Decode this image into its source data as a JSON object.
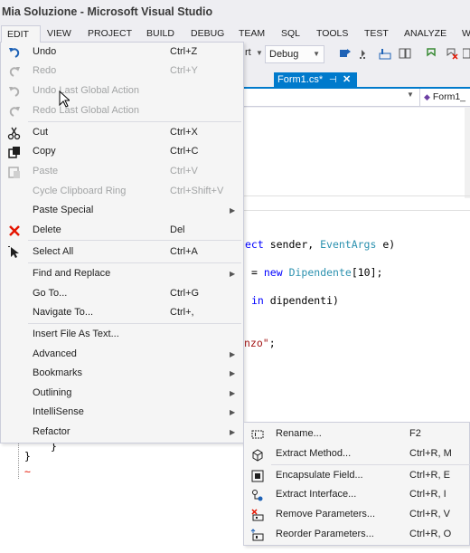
{
  "window": {
    "title": "Mia Soluzione - Microsoft Visual Studio"
  },
  "menubar": {
    "items": [
      "EDIT",
      "VIEW",
      "PROJECT",
      "BUILD",
      "DEBUG",
      "TEAM",
      "SQL",
      "TOOLS",
      "TEST",
      "ANALYZE",
      "W"
    ]
  },
  "toolbar": {
    "start_fragment": "rt",
    "config": "Debug"
  },
  "tabs": [
    {
      "label": "Form1.cs*",
      "pin": "⊣",
      "close": "✕"
    }
  ],
  "navbar": {
    "member": "Form1_"
  },
  "code": {
    "line1": {
      "a": "ect ",
      "b": "sender, ",
      "c": "EventArgs",
      "d": " e)"
    },
    "line2": {
      "a": "= ",
      "b": "new",
      "c": " ",
      "d": "Dipendente",
      "e": "[10];"
    },
    "line3": {
      "a": "in",
      "b": " dipendenti)"
    },
    "line4": {
      "a": "nzo\"",
      "b": ";"
    },
    "brace1": "}",
    "brace2": "}",
    "squiggle": "~"
  },
  "edit_menu": {
    "items": [
      {
        "label": "Undo",
        "shortcut": "Ctrl+Z",
        "icon": "undo-icon",
        "enabled": true
      },
      {
        "label": "Redo",
        "shortcut": "Ctrl+Y",
        "icon": "redo-icon",
        "enabled": false
      },
      {
        "label": "Undo Last Global Action",
        "shortcut": "",
        "icon": "undo-global-icon",
        "enabled": false
      },
      {
        "label": "Redo Last Global Action",
        "shortcut": "",
        "icon": "redo-global-icon",
        "enabled": false
      },
      {
        "label": "Cut",
        "shortcut": "Ctrl+X",
        "icon": "cut-icon",
        "enabled": true
      },
      {
        "label": "Copy",
        "shortcut": "Ctrl+C",
        "icon": "copy-icon",
        "enabled": true
      },
      {
        "label": "Paste",
        "shortcut": "Ctrl+V",
        "icon": "paste-icon",
        "enabled": false
      },
      {
        "label": "Cycle Clipboard Ring",
        "shortcut": "Ctrl+Shift+V",
        "icon": "",
        "enabled": false
      },
      {
        "label": "Paste Special",
        "shortcut": "",
        "icon": "",
        "enabled": true,
        "submenu": true
      },
      {
        "label": "Delete",
        "shortcut": "Del",
        "icon": "delete-icon",
        "enabled": true
      },
      {
        "label": "Select All",
        "shortcut": "Ctrl+A",
        "icon": "select-all-icon",
        "enabled": true
      },
      {
        "label": "Find and Replace",
        "shortcut": "",
        "icon": "",
        "enabled": true,
        "submenu": true
      },
      {
        "label": "Go To...",
        "shortcut": "Ctrl+G",
        "icon": "",
        "enabled": true
      },
      {
        "label": "Navigate To...",
        "shortcut": "Ctrl+,",
        "icon": "",
        "enabled": true
      },
      {
        "label": "Insert File As Text...",
        "shortcut": "",
        "icon": "",
        "enabled": true
      },
      {
        "label": "Advanced",
        "shortcut": "",
        "icon": "",
        "enabled": true,
        "submenu": true
      },
      {
        "label": "Bookmarks",
        "shortcut": "",
        "icon": "",
        "enabled": true,
        "submenu": true
      },
      {
        "label": "Outlining",
        "shortcut": "",
        "icon": "",
        "enabled": true,
        "submenu": true
      },
      {
        "label": "IntelliSense",
        "shortcut": "",
        "icon": "",
        "enabled": true,
        "submenu": true
      },
      {
        "label": "Refactor",
        "shortcut": "",
        "icon": "",
        "enabled": true,
        "submenu": true
      }
    ],
    "submenu_arrow": "▶"
  },
  "refactor_menu": {
    "items": [
      {
        "label": "Rename...",
        "shortcut": "F2",
        "icon": "rename-icon"
      },
      {
        "label": "Extract Method...",
        "shortcut": "Ctrl+R, M",
        "icon": "extract-method-icon"
      },
      {
        "label": "Encapsulate Field...",
        "shortcut": "Ctrl+R, E",
        "icon": "encapsulate-field-icon"
      },
      {
        "label": "Extract Interface...",
        "shortcut": "Ctrl+R, I",
        "icon": "extract-interface-icon"
      },
      {
        "label": "Remove Parameters...",
        "shortcut": "Ctrl+R, V",
        "icon": "remove-parameters-icon"
      },
      {
        "label": "Reorder Parameters...",
        "shortcut": "Ctrl+R, O",
        "icon": "reorder-parameters-icon"
      }
    ]
  },
  "colors": {
    "accent": "#007acc",
    "menu_bg": "#f5f5f5",
    "disabled_text": "#a2a4a5",
    "delete_red": "#e51400"
  }
}
